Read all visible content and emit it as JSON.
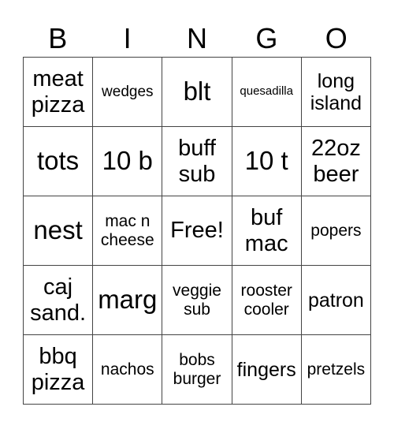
{
  "header": {
    "letters": [
      "B",
      "I",
      "N",
      "G",
      "O"
    ]
  },
  "grid": {
    "rows": [
      [
        "meat pizza",
        "wedges",
        "blt",
        "quesadilla",
        "long island"
      ],
      [
        "tots",
        "10 b",
        "buff sub",
        "10 t",
        "22oz beer"
      ],
      [
        "nest",
        "mac n cheese",
        "Free!",
        "buf mac",
        "popers"
      ],
      [
        "caj sand.",
        "marg",
        "veggie sub",
        "rooster cooler",
        "patron"
      ],
      [
        "bbq pizza",
        "nachos",
        "bobs burger",
        "fingers",
        "pretzels"
      ]
    ]
  }
}
